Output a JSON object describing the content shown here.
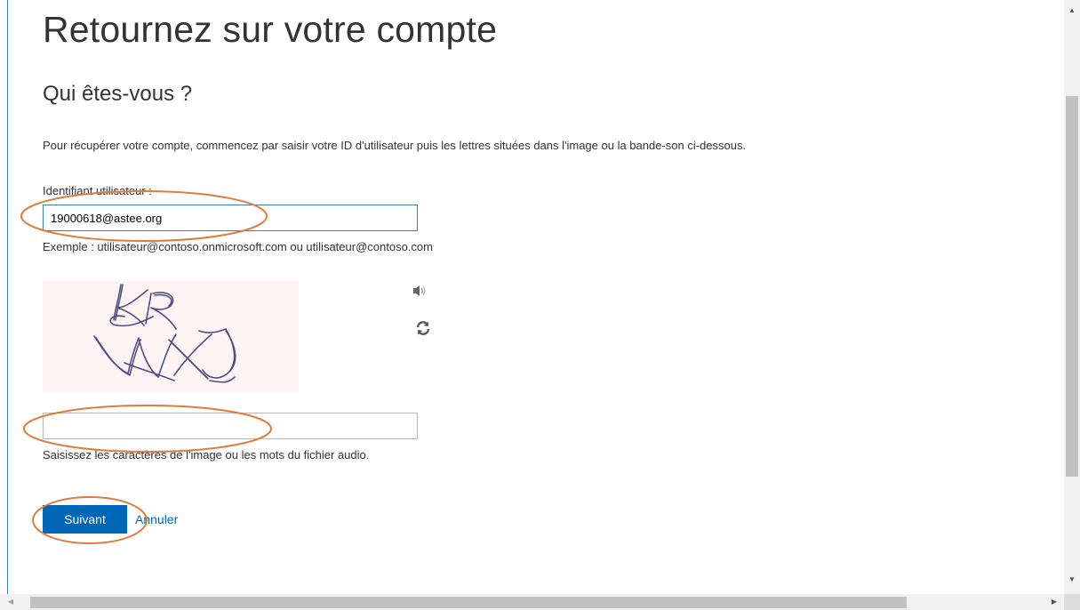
{
  "page": {
    "title": "Retournez sur votre compte",
    "section_title": "Qui êtes-vous ?",
    "intro": "Pour récupérer votre compte, commencez par saisir votre ID d'utilisateur puis les lettres situées dans l'image ou la bande-son ci-dessous."
  },
  "userid": {
    "label": "Identifiant utilisateur :",
    "value": "19000618@astee.org",
    "example": "Exemple : utilisateur@contoso.onmicrosoft.com ou utilisateur@contoso.com"
  },
  "captcha": {
    "image_icon": "captcha-image",
    "audio_icon": "speaker-icon",
    "refresh_icon": "refresh-icon",
    "input_value": "",
    "hint": "Saisissez les caractères de l'image ou les mots du fichier audio."
  },
  "actions": {
    "next_label": "Suivant",
    "cancel_label": "Annuler"
  },
  "colors": {
    "accent": "#0067b8",
    "annotation": "#e07b39",
    "focus_border": "#3b7bbf"
  },
  "scrollbars": {
    "up_arrow": "▲",
    "down_arrow": "▼",
    "left_arrow": "◀",
    "right_arrow": "▶"
  }
}
